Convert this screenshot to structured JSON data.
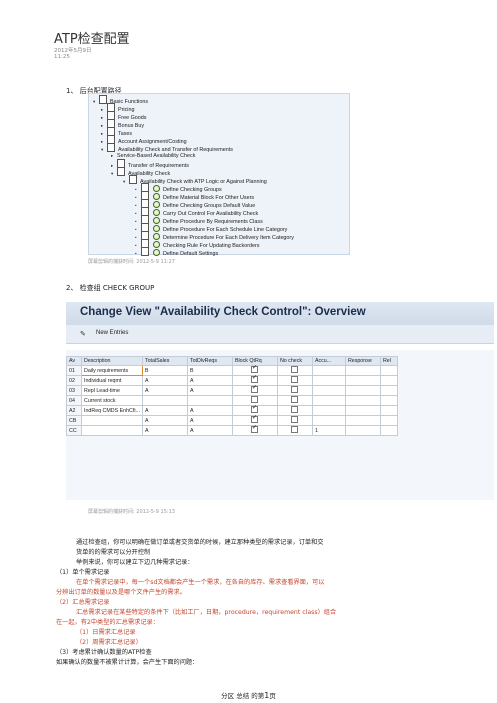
{
  "header": {
    "title": "ATP检查配置",
    "date": "2012年5月9日",
    "time": "11:25"
  },
  "section1": {
    "label": "1、 后台配置路径"
  },
  "tree": [
    {
      "label": "Basic Functions",
      "mark": "▾",
      "icon": "doc"
    },
    {
      "label": "Pricing",
      "mark": "▸",
      "icon": "doc"
    },
    {
      "label": "Free Goods",
      "mark": "▸",
      "icon": "doc"
    },
    {
      "label": "Bonus Buy",
      "mark": "▸",
      "icon": "doc"
    },
    {
      "label": "Taxes",
      "mark": "▸",
      "icon": "doc"
    },
    {
      "label": "Account Assignment/Costing",
      "mark": "▸",
      "icon": "doc"
    },
    {
      "label": "Availability Check and Transfer of Requirements",
      "mark": "▾",
      "icon": "doc"
    },
    {
      "label": "Service-Based Availability Check",
      "mark": "▸",
      "icon": ""
    },
    {
      "label": "Transfer of Requirements",
      "mark": "▸",
      "icon": "doc"
    },
    {
      "label": "Availability Check",
      "mark": "▾",
      "icon": "doc"
    },
    {
      "label": "Availability Check with ATP Logic or Against Planning",
      "mark": "▾",
      "icon": "doc"
    },
    {
      "label": "Define Checking Groups",
      "mark": "•",
      "icon": "both"
    },
    {
      "label": "Define Material Block For Other Users",
      "mark": "•",
      "icon": "both"
    },
    {
      "label": "Define Checking Groups Default Value",
      "mark": "•",
      "icon": "both"
    },
    {
      "label": "Carry Out Control For Availability Check",
      "mark": "•",
      "icon": "both"
    },
    {
      "label": "Define Procedure By Requirements Class",
      "mark": "•",
      "icon": "both"
    },
    {
      "label": "Define Procedure For Each Schedule Line Category",
      "mark": "•",
      "icon": "both"
    },
    {
      "label": "Determine Procedure For Each Delivery Item Category",
      "mark": "•",
      "icon": "both"
    },
    {
      "label": "Checking Rule For Updating Backorders",
      "mark": "•",
      "icon": "both"
    },
    {
      "label": "Define Default Settings",
      "mark": "•",
      "icon": "both"
    }
  ],
  "caption1": "屏幕剪辑的捕获时间: 2012-5-9 11:27",
  "section2": {
    "label": "2、 检查组 CHECK GROUP"
  },
  "sap": {
    "title": "Change View \"Availability Check Control\": Overview",
    "new_entries": "New Entries",
    "columns": [
      "Av",
      "Description",
      "TotalSales",
      "TotDlvReqs",
      "Block QtRq",
      "No check",
      "Accu...",
      "Response",
      "Rel"
    ],
    "rows": [
      {
        "av": "01",
        "desc": "Daily requirements",
        "ts": "B",
        "td": "B",
        "block": true,
        "nocheck": false,
        "accu": "",
        "resp": ""
      },
      {
        "av": "02",
        "desc": "Individual reqmt",
        "ts": "A",
        "td": "A",
        "block": true,
        "nocheck": false,
        "accu": "",
        "resp": ""
      },
      {
        "av": "03",
        "desc": "Repl Lead-time",
        "ts": "A",
        "td": "A",
        "block": true,
        "nocheck": false,
        "accu": "",
        "resp": ""
      },
      {
        "av": "04",
        "desc": "Current stock",
        "ts": "",
        "td": "",
        "block": false,
        "nocheck": false,
        "accu": "",
        "resp": ""
      },
      {
        "av": "A2",
        "desc": "IndReq CMDS EnhCfi...",
        "ts": "A",
        "td": "A",
        "block": true,
        "nocheck": false,
        "accu": "",
        "resp": ""
      },
      {
        "av": "CB",
        "desc": "",
        "ts": "A",
        "td": "A",
        "block": true,
        "nocheck": false,
        "accu": "",
        "resp": ""
      },
      {
        "av": "CC",
        "desc": "",
        "ts": "A",
        "td": "A",
        "block": true,
        "nocheck": false,
        "accu": "1",
        "resp": ""
      }
    ]
  },
  "caption2": "屏幕剪辑的捕获时间: 2012-5-9 15:13",
  "text": {
    "p1": "通过检查组，你可以明确在做订单或者交货单的时候，建立那种类型的需求记录，订单和交",
    "p2": "货单的的需求可以分开控制",
    "p3": "举例来说，你可以建立下边几种需求记录：",
    "i1": "（1）单个需求记录",
    "i1a": "在单个需求记录中，每一个sd文档都会产生一个需求，在各自的库存、需求查看界面，可以",
    "i1b": "分辨出订单的数量以及是哪个文件产生的需求。",
    "i2": "（2）汇总需求记录",
    "i2a": "汇总需求记录在某些特定的条件下（比如工厂，日期，procedure，requirement class）组合",
    "i2b": "在一起，有2中类型的汇总需求记录：",
    "i2c": "（1）日需求汇总记录",
    "i2d": "（2）周需求汇总记录）",
    "i3": "（3）考虑累计确认数量的ATP检查",
    "i3a": "如果确认的数量不被累计计算，会产生下面的问题："
  },
  "footer": {
    "a": "分区 总结 的第",
    "n": "1",
    "b": "页"
  }
}
